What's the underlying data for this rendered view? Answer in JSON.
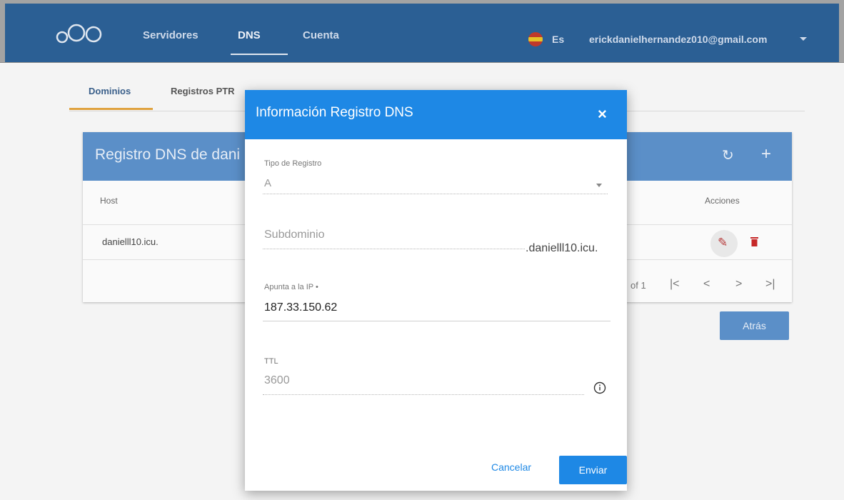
{
  "topbar": {
    "nav": [
      "Servidores",
      "DNS",
      "Cuenta"
    ],
    "language": "Es",
    "user_email": "erickdanielhernandez010@gmail.com",
    "logo_icon": "cloud-logo-icon",
    "colors": {
      "bar": "#2b5f94",
      "accent": "#1e88e5"
    }
  },
  "subtabs": {
    "dominios": "Dominios",
    "ptr": "Registros PTR"
  },
  "card": {
    "title": "Registro DNS de dani",
    "columns": {
      "host": "Host",
      "actions": "Acciones"
    },
    "rows": [
      {
        "host": "danielll10.icu."
      }
    ],
    "pager": {
      "of_text": "of 1",
      "first": "|<",
      "prev": "<",
      "next": ">",
      "last": ">|"
    },
    "refresh_icon": "↻",
    "add_icon": "+",
    "back_label": "Atrás"
  },
  "modal": {
    "title": "Información Registro DNS",
    "close": "×",
    "record_type": {
      "label": "Tipo de Registro",
      "value": "A"
    },
    "subdomain": {
      "placeholder": "Subdominio",
      "suffix": ".danielll10.icu."
    },
    "ip": {
      "label": "Apunta a la IP •",
      "value": "187.33.150.62"
    },
    "ttl": {
      "label": "TTL",
      "value": "3600"
    },
    "cancel_label": "Cancelar",
    "submit_label": "Enviar"
  }
}
